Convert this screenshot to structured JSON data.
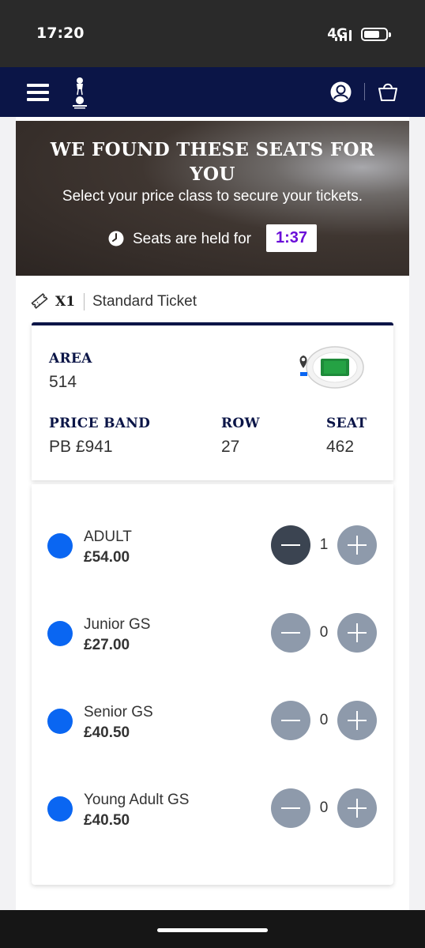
{
  "status_bar": {
    "time": "17:20",
    "network": "4G",
    "battery_level": 0.6
  },
  "nav": {
    "menu_icon": "hamburger-menu-icon",
    "logo": "club-crest-logo",
    "account_icon": "user-icon",
    "basket_icon": "basket-icon",
    "background_color": "#0b1547"
  },
  "hero": {
    "title": "WE FOUND THESE SEATS FOR YOU",
    "subtitle": "Select your price class to secure your tickets.",
    "held_label": "Seats are held for",
    "countdown": "1:37",
    "countdown_color": "#6a0dd8"
  },
  "ticket": {
    "quantity": "X1",
    "type": "Standard Ticket"
  },
  "seat": {
    "area_label": "AREA",
    "area_value": "514",
    "price_band_label": "PRICE BAND",
    "price_band_value": "PB £941",
    "row_label": "ROW",
    "row_value": "27",
    "seat_label": "SEAT",
    "seat_value": "462"
  },
  "price_classes": [
    {
      "name": "ADULT",
      "price": "£54.00",
      "count": "1"
    },
    {
      "name": "Junior GS",
      "price": "£27.00",
      "count": "0"
    },
    {
      "name": "Senior GS",
      "price": "£40.50",
      "count": "0"
    },
    {
      "name": "Young Adult GS",
      "price": "£40.50",
      "count": "0"
    }
  ],
  "colors": {
    "price_dot": "#0a66f2",
    "stepper_active": "#3b4451",
    "stepper_inactive": "#8e9aab"
  }
}
